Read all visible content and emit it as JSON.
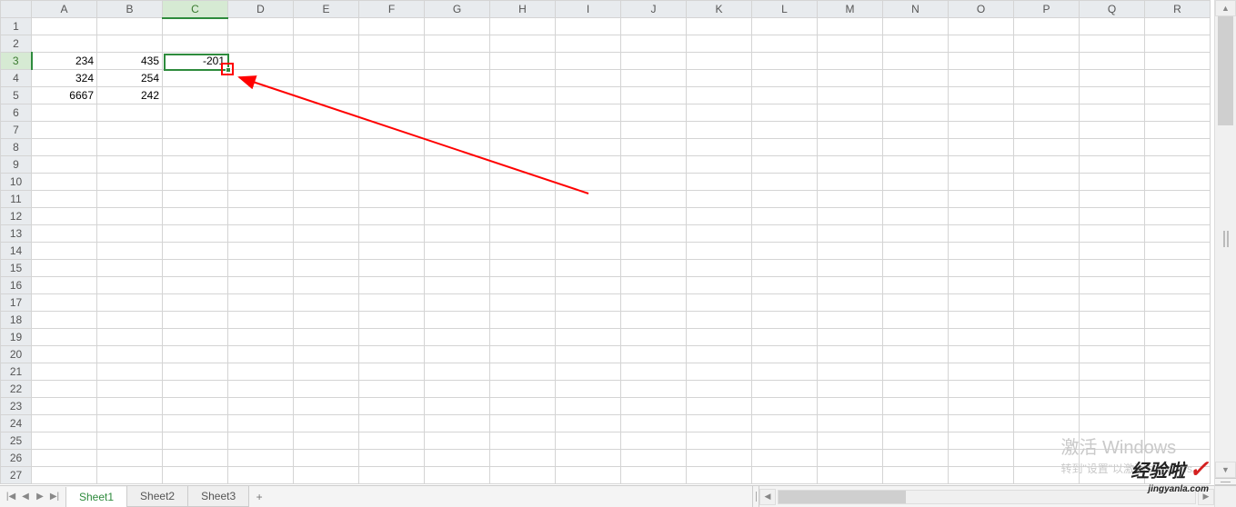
{
  "columns": [
    "A",
    "B",
    "C",
    "D",
    "E",
    "F",
    "G",
    "H",
    "I",
    "J",
    "K",
    "L",
    "M",
    "N",
    "O",
    "P",
    "Q",
    "R"
  ],
  "visible_rows": 27,
  "active_cell": {
    "col": "C",
    "row": 3,
    "col_index": 2,
    "row_index": 2
  },
  "cells": {
    "A3": "234",
    "B3": "435",
    "C3": "-201",
    "A4": "324",
    "B4": "254",
    "A5": "6667",
    "B5": "242"
  },
  "tabs": [
    {
      "label": "Sheet1",
      "active": true
    },
    {
      "label": "Sheet2",
      "active": false
    },
    {
      "label": "Sheet3",
      "active": false
    }
  ],
  "tab_nav": {
    "first": "|◀",
    "prev": "◀",
    "next": "▶",
    "last": "▶|",
    "add": "+"
  },
  "watermark": {
    "line1": "激活 Windows",
    "line2": "转到\"设置\"以激活 Windows。"
  },
  "brand": {
    "name": "经验啦",
    "url": "jingyanla.com",
    "check": "✓"
  }
}
